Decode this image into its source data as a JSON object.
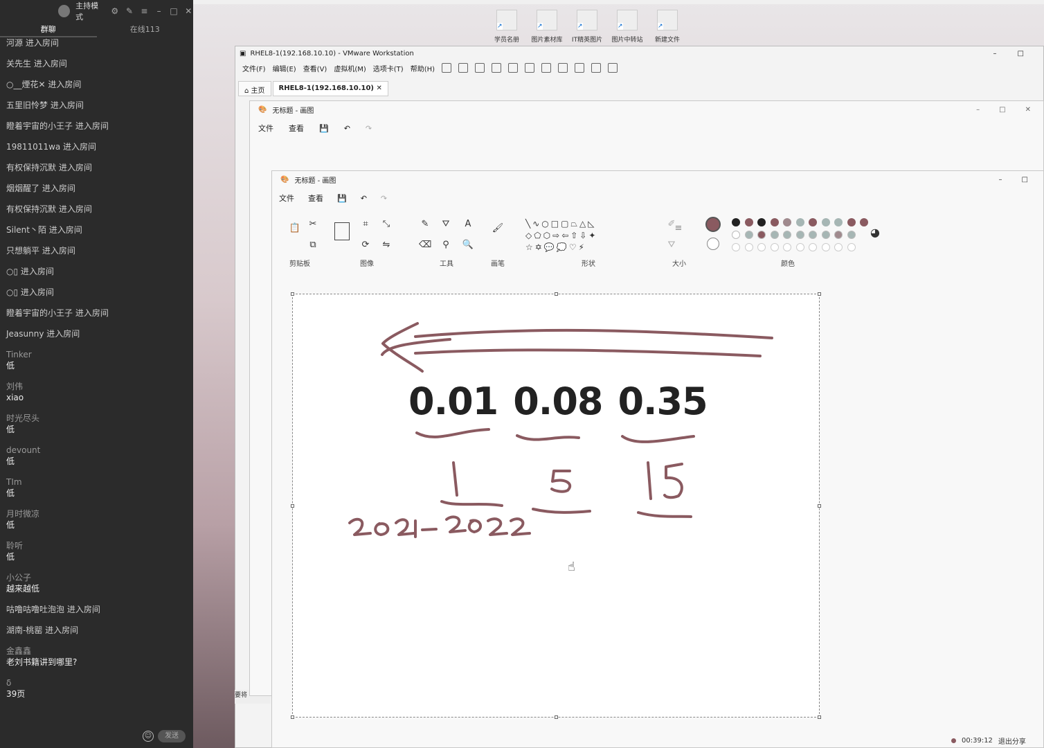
{
  "chat": {
    "mode_label": "主持模式",
    "tab_chat": "群聊",
    "tab_online": "在线113",
    "messages": [
      {
        "text": "河源 进入房间"
      },
      {
        "text": "关先生 进入房间"
      },
      {
        "text": "○__煙花✕     进入房间"
      },
      {
        "text": "五里旧怜梦 进入房间"
      },
      {
        "text": "瞪着宇宙的小王子 进入房间"
      },
      {
        "text": "19811011wa 进入房间"
      },
      {
        "text": "有权保持沉默 进入房间"
      },
      {
        "text": "烟烟醒了 进入房间"
      },
      {
        "text": "有权保持沉默 进入房间"
      },
      {
        "text": "Silent丶陌 进入房间"
      },
      {
        "text": "只想躺平 进入房间"
      },
      {
        "text": "○▯ 进入房间"
      },
      {
        "text": "○▯ 进入房间"
      },
      {
        "text": "瞪着宇宙的小王子 进入房间"
      },
      {
        "text": "Jeasunny 进入房间"
      }
    ],
    "posts": [
      {
        "user": "Tinker",
        "text": "低"
      },
      {
        "user": "刘伟",
        "text": "xiao"
      },
      {
        "user": "时光尽头",
        "text": "低"
      },
      {
        "user": "devount",
        "text": "低"
      },
      {
        "user": "TIm",
        "text": "低"
      },
      {
        "user": "月时微凉",
        "text": "低"
      },
      {
        "user": "聆听",
        "text": "低"
      },
      {
        "user": "小公子",
        "text": "越来越低"
      }
    ],
    "messages2": [
      {
        "text": "咕噜咕噜吐泡泡 进入房间"
      },
      {
        "text": "湖南-桃罂 进入房间"
      }
    ],
    "posts2": [
      {
        "user": "金鑫鑫",
        "text": "老刘书籍讲到哪里?"
      },
      {
        "user": "δ",
        "text": "39页"
      }
    ],
    "send_label": "发送"
  },
  "desktop": {
    "icons": [
      "学员名册",
      "图片素材库",
      "IT精英图片",
      "图片中转站",
      "新建文件"
    ]
  },
  "vmware": {
    "title": "RHEL8-1(192.168.10.10) - VMware Workstation",
    "menu": [
      "文件(F)",
      "编辑(E)",
      "查看(V)",
      "虚拟机(M)",
      "选项卡(T)",
      "帮助(H)"
    ],
    "tab_home": "主页",
    "tab_vm": "RHEL8-1(192.168.10.10)",
    "bottom_label": "要将"
  },
  "paint_back": {
    "title": "无标题 - 画图",
    "menu_file": "文件",
    "menu_view": "查看"
  },
  "paint_front": {
    "title": "无标题 - 画图",
    "menu_file": "文件",
    "menu_view": "查看",
    "groups": {
      "clipboard": "剪贴板",
      "image": "图像",
      "tools": "工具",
      "brush": "画笔",
      "shapes": "形状",
      "size": "大小",
      "colors": "颜色"
    },
    "colors": {
      "primary": "#8a5a60",
      "palette_row1": [
        "#222222",
        "#8a5a60",
        "#222222",
        "#8a5a60",
        "#a08a8e",
        "#a6b6b4",
        "#8a5a60",
        "#a6b6b4",
        "#a6b6b4",
        "#8a5a60",
        "#8a5a60"
      ],
      "palette_row2": [
        "#ffffff",
        "#a6b6b4",
        "#8a5a60",
        "#a6b6b4",
        "#a6b6b4",
        "#a6b6b4",
        "#a6b6b4",
        "#a6b6b4",
        "#a08a8e",
        "#a6b6b4"
      ]
    }
  },
  "canvas": {
    "numbers": [
      "0.01",
      "0.08",
      "0.35"
    ],
    "handwritten": [
      "1",
      "5",
      "15",
      "2021-2022"
    ],
    "ink_color": "#8a5a60"
  },
  "status": {
    "timer": "00:39:12",
    "exit_label": "退出分享"
  }
}
